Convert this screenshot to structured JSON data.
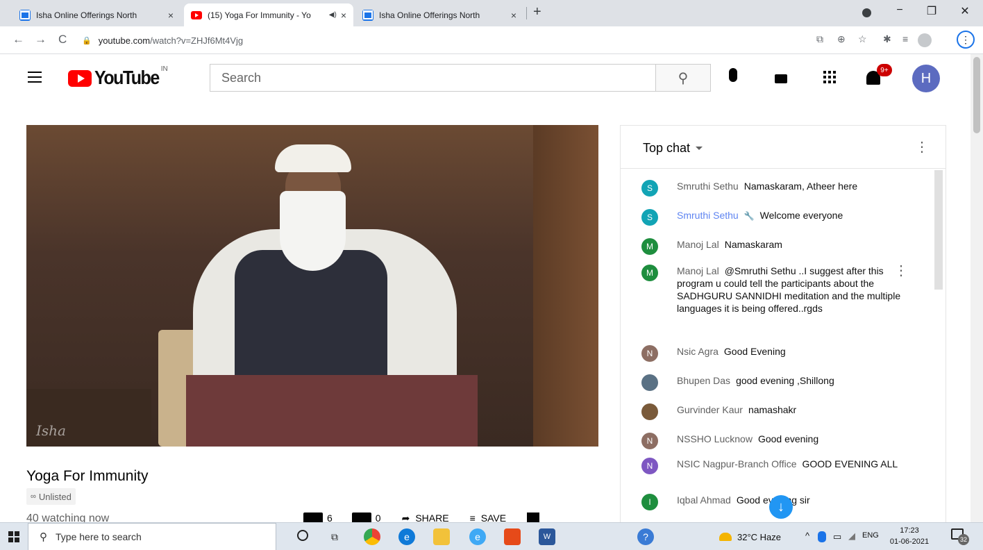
{
  "browser": {
    "tabs": [
      {
        "title": "Isha Online Offerings North",
        "close": "×"
      },
      {
        "title": "(15) Yoga For Immunity - Yo",
        "close": "×",
        "audio": "◀)"
      },
      {
        "title": "Isha Online Offerings North",
        "close": "×"
      }
    ],
    "new_tab": "+",
    "url_domain": "youtube.com",
    "url_path": "/watch?v=ZHJf6Mt4Vjg"
  },
  "youtube": {
    "logo_text": "YouTube",
    "region": "IN",
    "search_placeholder": "Search",
    "notif_count": "9+",
    "avatar_letter": "H"
  },
  "video": {
    "title": "Yoga For Immunity",
    "privacy": "Unlisted",
    "watching": "40 watching now",
    "likes": "6",
    "dislikes": "0",
    "share": "SHARE",
    "save": "SAVE",
    "watermark": "Isha"
  },
  "chat": {
    "header": "Top chat",
    "messages": [
      {
        "initial": "S",
        "color": "#12a4b5",
        "author": "Smruthi Sethu",
        "text": "Namaskaram, Atheer here"
      },
      {
        "initial": "S",
        "color": "#12a4b5",
        "author": "Smruthi Sethu",
        "text": "Welcome everyone",
        "moderator": true
      },
      {
        "initial": "M",
        "color": "#1e8e3e",
        "author": "Manoj Lal",
        "text": "Namaskaram"
      },
      {
        "initial": "M",
        "color": "#1e8e3e",
        "author": "Manoj Lal",
        "text": "@Smruthi Sethu ..I suggest after this program u could tell the participants about the SADHGURU SANNIDHI meditation and the multiple languages it is being offered..rgds"
      },
      {
        "initial": "N",
        "color": "#8d6e63",
        "author": "Nsic Agra",
        "text": "Good Evening"
      },
      {
        "initial": "",
        "color": "#5a7184",
        "author": "Bhupen Das",
        "text": "good evening ,Shillong"
      },
      {
        "initial": "",
        "color": "#7a5a3a",
        "author": "Gurvinder Kaur",
        "text": "namashakr"
      },
      {
        "initial": "N",
        "color": "#8d6e63",
        "author": "NSSHO Lucknow",
        "text": "Good evening"
      },
      {
        "initial": "N",
        "color": "#7e57c2",
        "author": "NSIC Nagpur-Branch Office",
        "text": "GOOD EVENING ALL"
      },
      {
        "initial": "I",
        "color": "#1e8e3e",
        "author": "Iqbal Ahmad",
        "text": "Good evening sir"
      }
    ]
  },
  "taskbar": {
    "search_placeholder": "Type here to search",
    "weather": "32°C  Haze",
    "lang": "ENG",
    "time": "17:23",
    "date": "01-06-2021",
    "notif": "32"
  }
}
